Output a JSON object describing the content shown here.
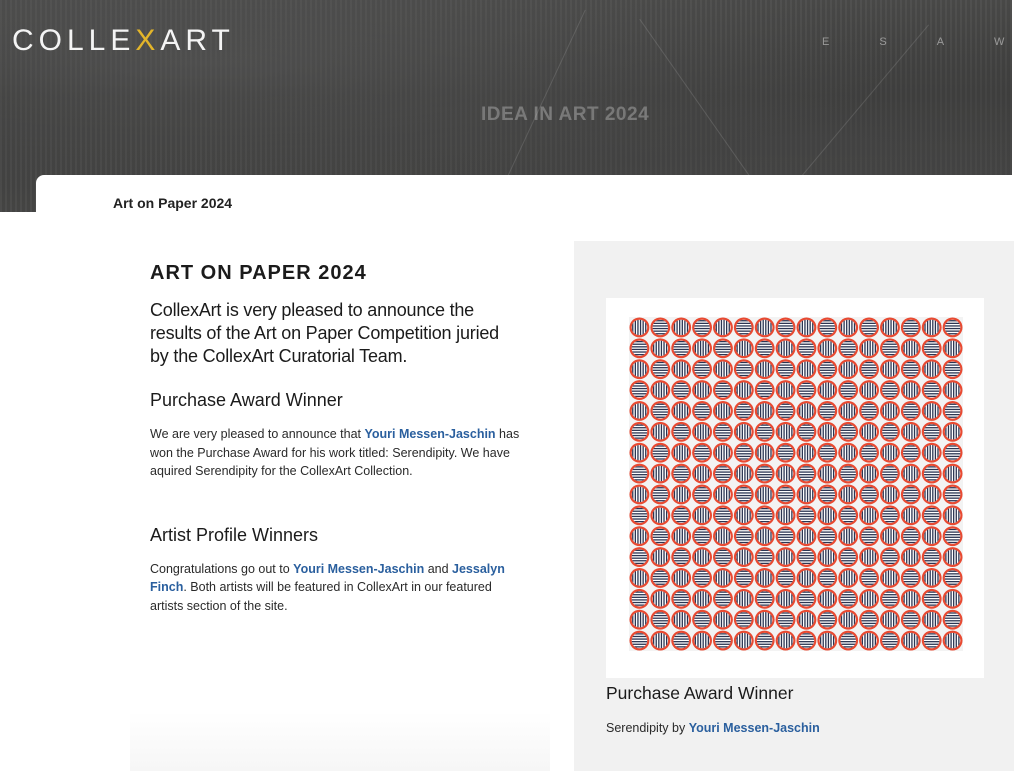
{
  "header": {
    "logo_prefix": "COLLE",
    "logo_x": "X",
    "logo_suffix": "ART",
    "nav_letters": [
      "E",
      "S",
      "A",
      "W"
    ],
    "hero_caption": "IDEA IN ART 2024"
  },
  "tab": {
    "label": "Art on Paper 2024"
  },
  "main": {
    "title": "ART ON PAPER 2024",
    "intro": "CollexArt is very pleased to announce the results of the Art on Paper Competition juried by the CollexArt Curatorial Team.",
    "purchase_heading": "Purchase Award Winner",
    "purchase_text_1": "We are very pleased to announce that ",
    "purchase_link": "Youri Messen-Jaschin",
    "purchase_text_2": " has won the Purchase Award for his work titled: Serendipity. We have aquired Serendipity for the CollexArt Collection.",
    "profile_heading": "Artist Profile Winners",
    "profile_text_1": "Congratulations go out to ",
    "profile_link_1": "Youri Messen-Jaschin",
    "profile_text_2": " and ",
    "profile_link_2": "Jessalyn Finch",
    "profile_text_3": ".  Both artists will be featured in CollexArt in our featured artists section of the site."
  },
  "sidebar": {
    "caption_heading": "Purchase Award Winner",
    "caption_prefix": "Serendipity by ",
    "caption_link": "Youri Messen-Jaschin"
  },
  "colors": {
    "accent_logo": "#e3b52a",
    "link": "#2a5f9e",
    "artwork_red": "#e84a32",
    "artwork_stripe": "#2b3552",
    "sidebar_bg": "#f1f1f1"
  },
  "artwork": {
    "rows": 16,
    "cols": 16
  }
}
